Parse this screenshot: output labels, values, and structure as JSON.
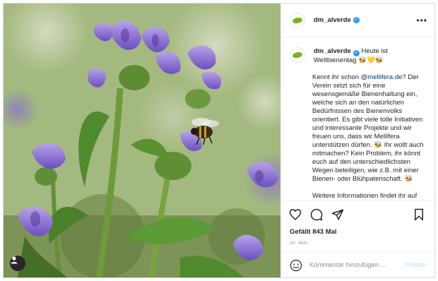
{
  "post": {
    "username": "dm_alverde",
    "verified_icon": "verified-badge-icon",
    "more_icon": "more-options-icon",
    "caption": {
      "username": "dm_alverde",
      "headline": "Heute ist Weltbienentag 🐝💛🐝",
      "paragraph1_pre": "Kennt ihr schon ",
      "mention": "@mellifera.de",
      "paragraph1_post": "? Der Verein setzt sich für eine wesensgemäße Bienenhaltung ein, welche sich an den natürlichen Bedürfnissen des Bienenvolks orientiert. Es gibt viele tolle Initiativen und interessante Projekte und wir freuen uns, dass wir Mellifera unterstützen dürfen. 🐝 Ihr wollt auch mitmachen? Kein Problem, ihr könnt euch auf den unterschiedlichsten Wegen beteiligen, wie z.B. mit einer Bienen- oder Blühpatenschaft. 🐝",
      "paragraph2": "Weitere Informationen findet ihr auf www.mellifera.de"
    },
    "likes": "Gefällt 843 Mal",
    "date": "20. MAI",
    "comment_input": {
      "placeholder": "Kommentar hinzufügen ...",
      "value": ""
    },
    "post_button": "Posten",
    "colors": {
      "brand_green": "#7ab51d",
      "verified_blue": "#3897f0",
      "link": "#00376b",
      "post_button_disabled": "#b2dffc"
    }
  },
  "image": {
    "description_icon": "user-tag-icon"
  }
}
